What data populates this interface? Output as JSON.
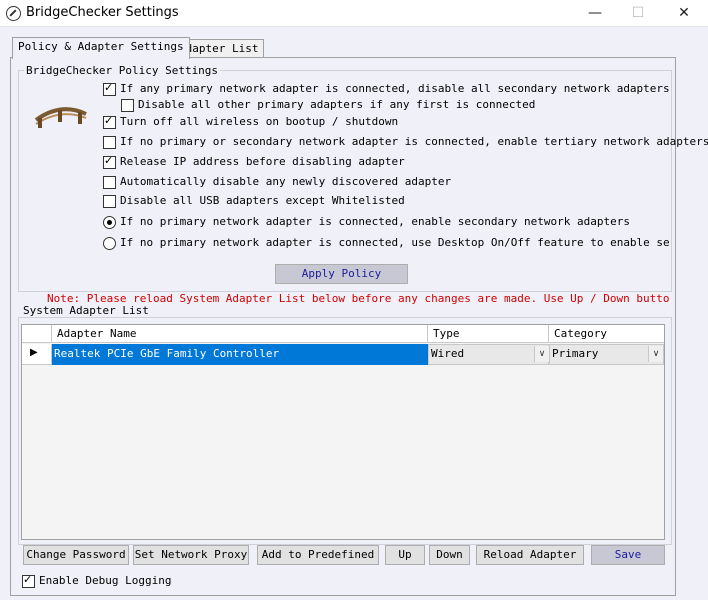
{
  "window": {
    "title": "BridgeChecker Settings",
    "minimize": "—",
    "maximize": "☐",
    "close": "✕"
  },
  "tabs": [
    {
      "label": "Policy & Adapter Settings",
      "active": true
    },
    {
      "label": "Adapter List",
      "active": false
    }
  ],
  "policy_group": {
    "title": "BridgeChecker Policy Settings",
    "options": [
      {
        "label": "If any primary network adapter is connected, disable all secondary network adapters",
        "checked": true
      },
      {
        "label": "Disable all other primary adapters if any first is connected",
        "checked": false
      },
      {
        "label": "Turn off all wireless on bootup / shutdown",
        "checked": true
      },
      {
        "label": "If no primary or secondary network adapter is connected, enable tertiary network adapters",
        "checked": false
      },
      {
        "label": "Release IP address before disabling adapter",
        "checked": true
      },
      {
        "label": "Automatically disable any newly discovered adapter",
        "checked": false
      },
      {
        "label": "Disable all USB adapters except Whitelisted",
        "checked": false
      }
    ],
    "radios": [
      {
        "label": "If no primary network adapter is connected, enable secondary network adapters",
        "checked": true
      },
      {
        "label": "If no primary network adapter is connected, use Desktop On/Off feature to enable secondary n",
        "checked": false
      }
    ],
    "apply_button": "Apply Policy"
  },
  "note": "Note: Please reload System Adapter List below before any changes are made. Use Up / Down buttons to",
  "adapter_group": {
    "title": "System Adapter List",
    "columns": [
      "Adapter Name",
      "Type",
      "Category"
    ],
    "rows": [
      {
        "name": "Realtek PCIe GbE Family Controller",
        "type": "Wired",
        "category": "Primary",
        "selected": true
      }
    ]
  },
  "buttons": {
    "change_password": "Change Password",
    "set_network_proxy": "Set Network Proxy",
    "add_to_predefined": "Add to Predefined",
    "up": "Up",
    "down": "Down",
    "reload_adapter": "Reload Adapter",
    "save": "Save"
  },
  "debug": {
    "label": "Enable Debug Logging",
    "checked": true
  }
}
